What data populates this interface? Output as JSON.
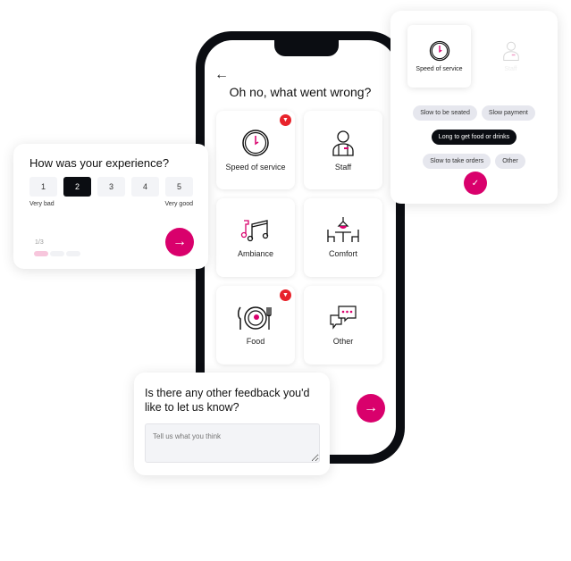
{
  "colors": {
    "accent": "#d9006c",
    "badge": "#e8232b",
    "dark": "#0b0d12"
  },
  "phone": {
    "back_icon": "arrow-left-icon",
    "title": "Oh no, what went wrong?",
    "categories": [
      {
        "label": "Speed of service",
        "icon": "clock-icon",
        "flagged": true
      },
      {
        "label": "Staff",
        "icon": "staff-icon",
        "flagged": false
      },
      {
        "label": "Ambiance",
        "icon": "music-icon",
        "flagged": false
      },
      {
        "label": "Comfort",
        "icon": "table-lamp-icon",
        "flagged": false
      },
      {
        "label": "Food",
        "icon": "plate-icon",
        "flagged": true
      },
      {
        "label": "Other",
        "icon": "chat-icon",
        "flagged": false
      }
    ],
    "next_icon": "arrow-right-icon"
  },
  "experience": {
    "title": "How was your experience?",
    "ratings": [
      "1",
      "2",
      "3",
      "4",
      "5"
    ],
    "selected": "2",
    "low_label": "Very bad",
    "high_label": "Very good",
    "step": "1/3",
    "progress_fraction": 0.333
  },
  "feedback": {
    "title": "Is there any other feedback you'd like to let us know?",
    "placeholder": "Tell us what you think"
  },
  "popup": {
    "selected_category": "Speed of service",
    "other_category": "Staff",
    "chips": [
      "Slow to be seated",
      "Slow payment",
      "Long to get food or drinks",
      "Slow to take orders",
      "Other"
    ],
    "selected_chip": "Long to get food or drinks",
    "confirm_icon": "check-icon"
  }
}
